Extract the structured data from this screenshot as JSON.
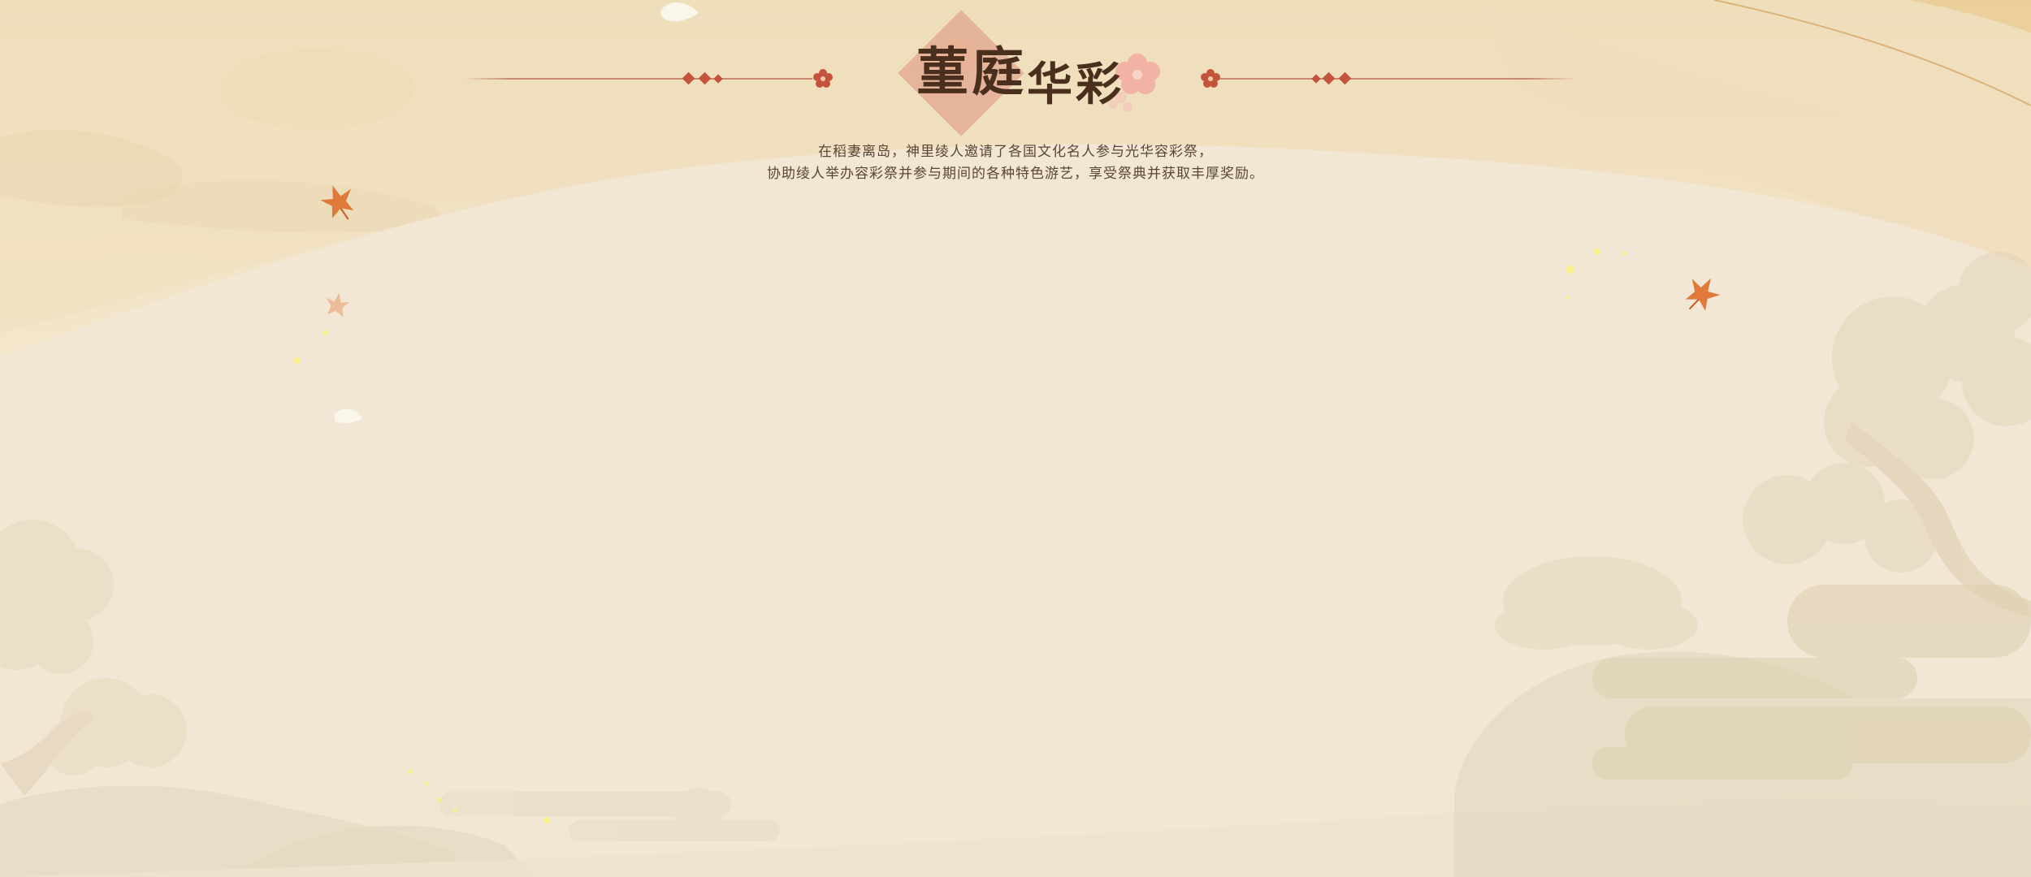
{
  "event": {
    "title": "菫庭华彩",
    "title_parts": [
      "菫",
      "庭",
      "华",
      "彩"
    ],
    "description_lines": [
      "在稻妻离岛，神里绫人邀请了各国文化名人参与光华容彩祭，",
      "协助绫人举办容彩祭并参与期间的各种特色游艺，享受祭典并获取丰厚奖励。"
    ]
  },
  "colors": {
    "background": "#f1e6d2",
    "title_text": "#4a2f1e",
    "accent_red": "#c4533b",
    "body_text": "#5b4536",
    "maple_orange": "#e07a3a"
  }
}
